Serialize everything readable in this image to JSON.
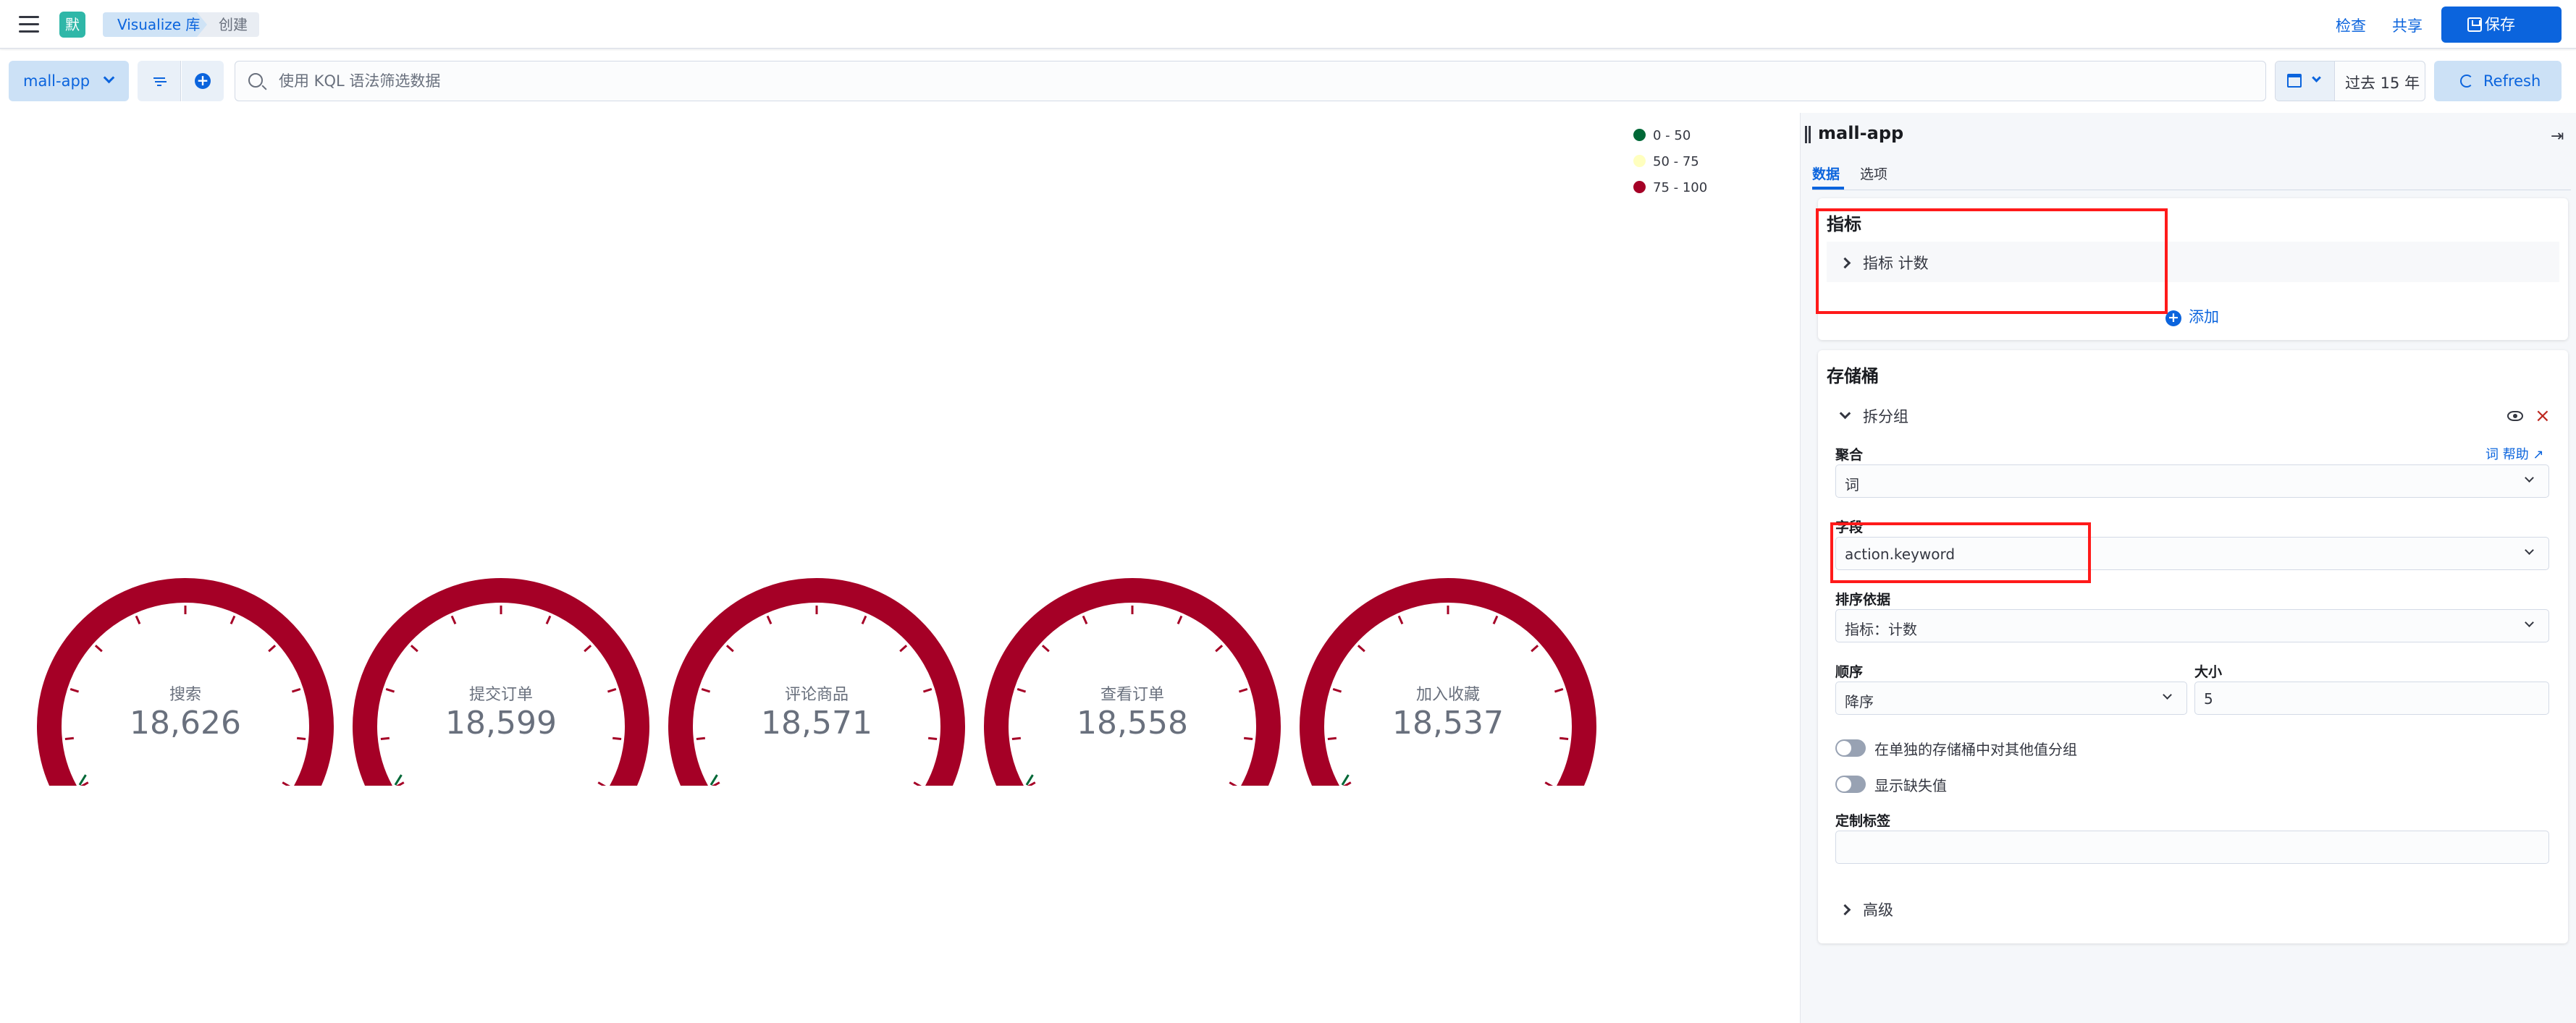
{
  "header": {
    "space_initial": "默",
    "breadcrumbs": [
      "Visualize 库",
      "创建"
    ],
    "inspect": "检查",
    "share": "共享",
    "save": "保存"
  },
  "querybar": {
    "data_view": "mall-app",
    "search_placeholder": "使用 KQL 语法筛选数据",
    "time_range": "过去 15 年",
    "refresh": "Refresh"
  },
  "legend": [
    {
      "label": "0 - 50",
      "color": "#006837"
    },
    {
      "label": "50 - 75",
      "color": "#ffffbf"
    },
    {
      "label": "75 - 100",
      "color": "#a50026"
    }
  ],
  "gauges": [
    {
      "label": "搜索",
      "value": "18,626"
    },
    {
      "label": "提交订单",
      "value": "18,599"
    },
    {
      "label": "评论商品",
      "value": "18,571"
    },
    {
      "label": "查看订单",
      "value": "18,558"
    },
    {
      "label": "加入收藏",
      "value": "18,537"
    }
  ],
  "gauge_color": "#a50026",
  "editor": {
    "title": "mall-app",
    "tabs": [
      "数据",
      "选项"
    ],
    "metrics": {
      "title": "指标",
      "item": "指标 计数",
      "add": "添加"
    },
    "buckets": {
      "title": "存储桶",
      "group": "拆分组",
      "agg_label": "聚合",
      "help": "词 帮助",
      "agg_value": "词",
      "field_label": "字段",
      "field_value": "action.keyword",
      "order_by_label": "排序依据",
      "order_by_value": "指标：计数",
      "order_label": "顺序",
      "order_value": "降序",
      "size_label": "大小",
      "size_value": "5",
      "switch_other": "在单独的存储桶中对其他值分组",
      "switch_missing": "显示缺失值",
      "custom_label": "定制标签",
      "advanced": "高级"
    }
  }
}
